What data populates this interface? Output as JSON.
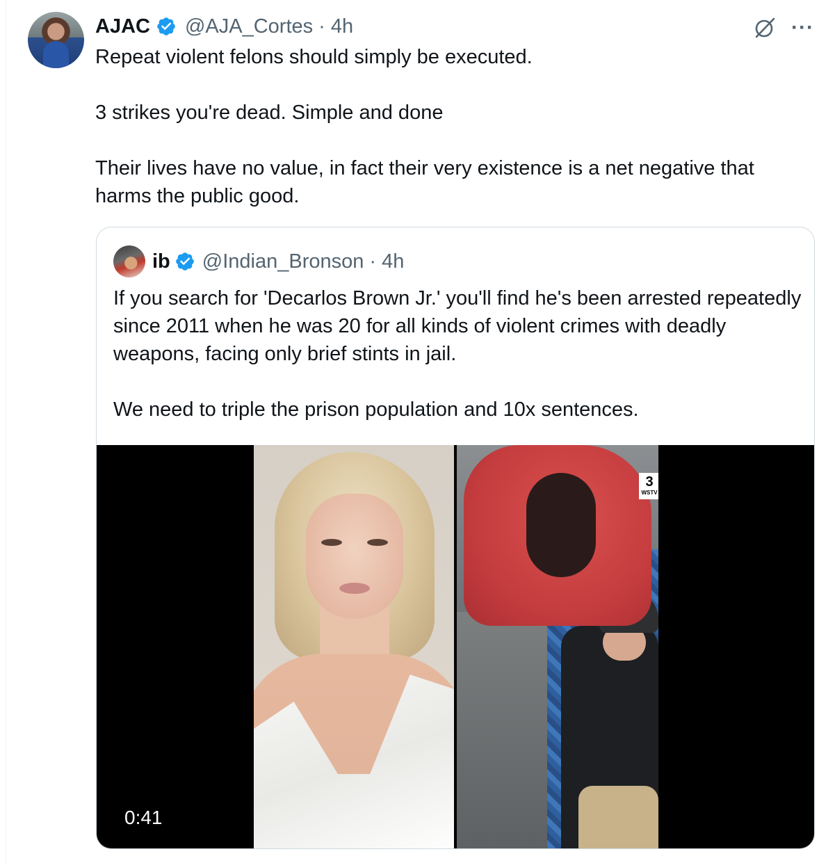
{
  "tweet": {
    "author_name": "AJAC",
    "author_handle": "@AJA_Cortes",
    "separator": "·",
    "time": "4h",
    "more_label": "···",
    "body": [
      "Repeat violent felons should simply be executed.",
      "3 strikes you're dead. Simple and done",
      "Their lives have no value, in fact their very existence is a net negative that harms the public good."
    ]
  },
  "quote": {
    "author_name": "ib",
    "author_handle": "@Indian_Bronson",
    "separator": "·",
    "time": "4h",
    "body": [
      "If you search for 'Decarlos Brown Jr.' you'll find he's been arrested repeatedly since 2011 when he was 20 for all kinds of violent crimes with deadly weapons, facing only brief stints in jail.",
      "We need to triple the prison population and 10x sentences."
    ],
    "video": {
      "duration": "0:41",
      "watermark_number": "3",
      "watermark_text": "WSTV"
    }
  },
  "colors": {
    "verified_blue": "#1d9bf0",
    "secondary_text": "#536471",
    "border": "#cfd9de"
  },
  "icons": [
    "verified-badge-icon",
    "grok-icon",
    "more-options-icon"
  ]
}
